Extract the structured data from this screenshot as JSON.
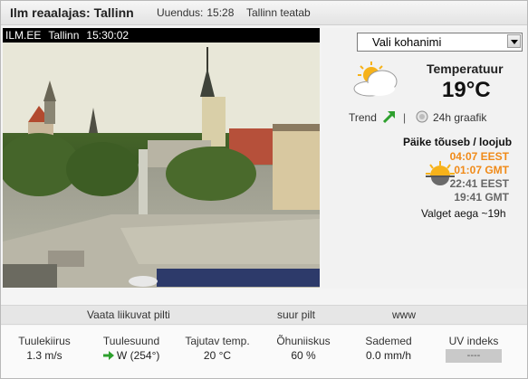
{
  "header": {
    "title": "Ilm reaalajas: Tallinn",
    "updated_label": "Uuendus:",
    "updated_time": "15:28",
    "report_link": "Tallinn teatab"
  },
  "webcam": {
    "source": "ILM.EE",
    "city": "Tallinn",
    "time": "15:30:02"
  },
  "panel": {
    "location_select": {
      "value": "Vali kohanimi"
    },
    "temperature_label": "Temperatuur",
    "temperature_value": "19°C",
    "weather_icon": "partly-cloudy-icon",
    "trend_label": "Trend",
    "trend_direction": "up",
    "separator": "|",
    "graph_link": "24h graafik",
    "sun": {
      "title": "Päike tõuseb / loojub",
      "sunrise_eest": "04:07 EEST",
      "sunrise_gmt": "01:07 GMT",
      "sunset_eest": "22:41 EEST",
      "sunset_gmt": "19:41 GMT",
      "daylight": "Valget aega ~19h"
    }
  },
  "links": {
    "moving_pictures": "Vaata liikuvat pilti",
    "large_picture": "suur pilt",
    "www": "www"
  },
  "stats": [
    {
      "label": "Tuulekiirus",
      "value": "1.3 m/s"
    },
    {
      "label": "Tuulesuund",
      "value": "W (254°)"
    },
    {
      "label": "Tajutav temp.",
      "value": "20 °C"
    },
    {
      "label": "Õhuniiskus",
      "value": "60 %"
    },
    {
      "label": "Sademed",
      "value": "0.0 mm/h"
    },
    {
      "label": "UV indeks",
      "value": "----"
    }
  ],
  "colors": {
    "sunrise": "#f08a18",
    "sunset": "#666666",
    "trend_up": "#2ea02e",
    "wind_arrow": "#2ea02e"
  }
}
